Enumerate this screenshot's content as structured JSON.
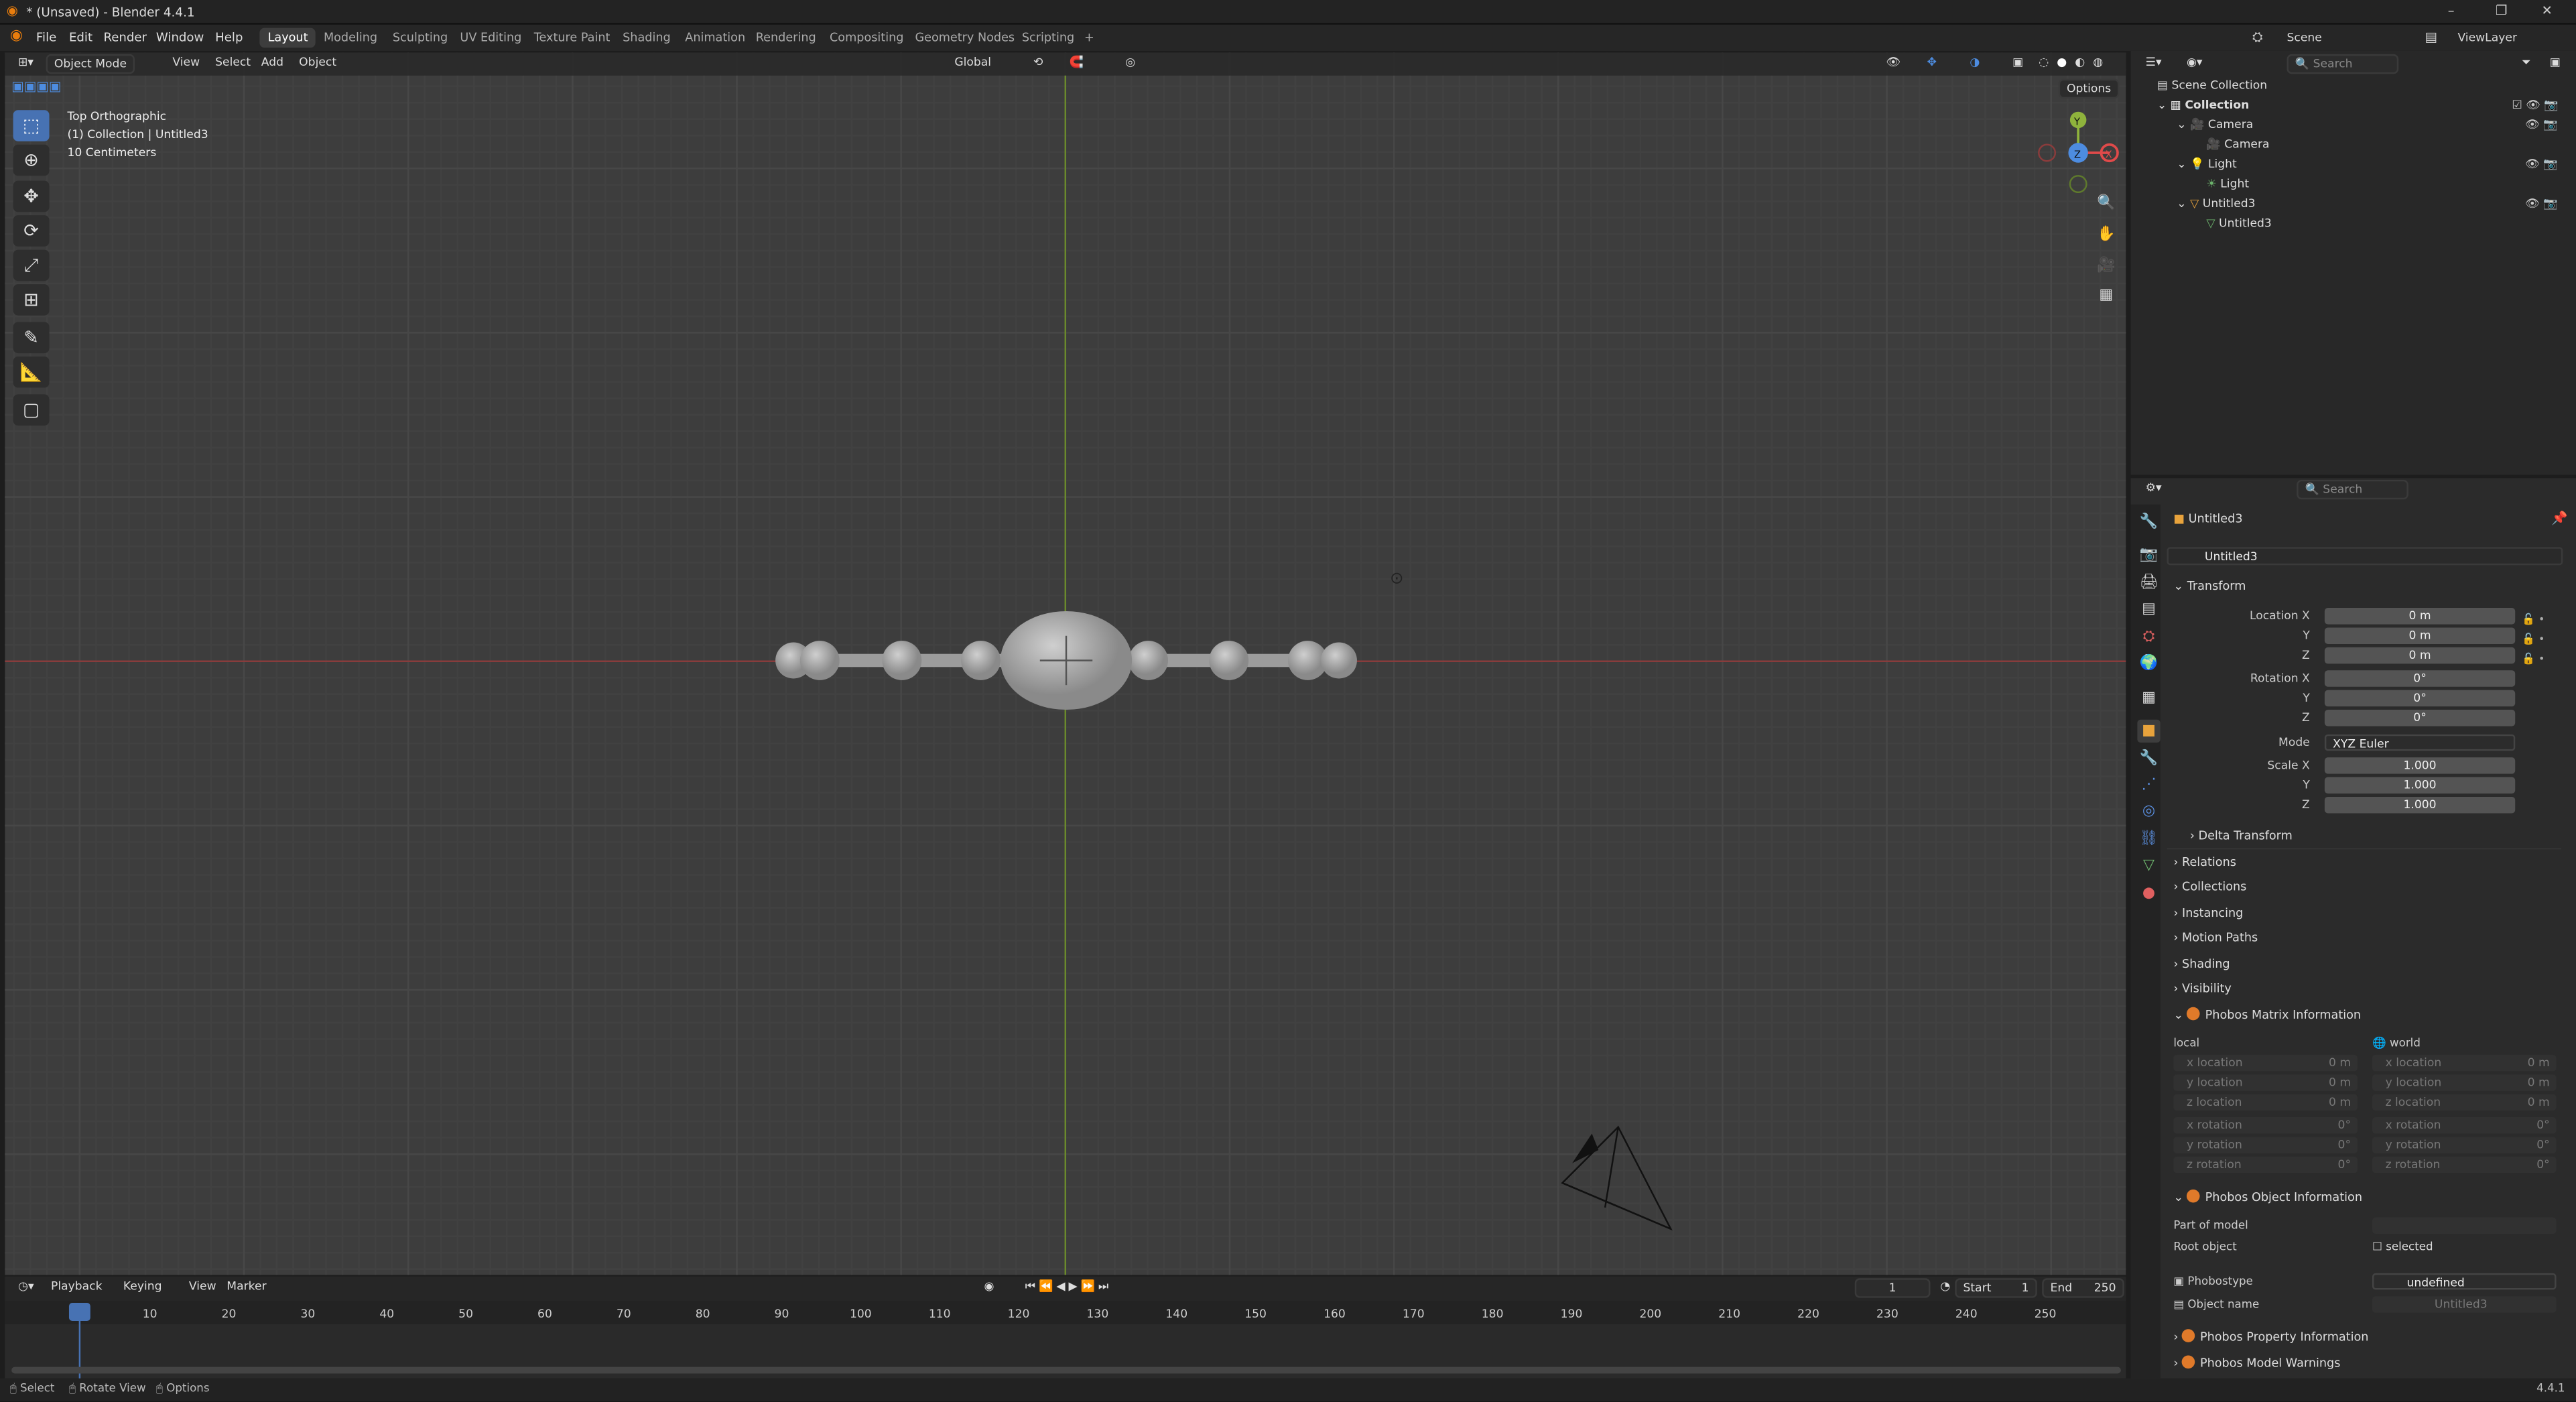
{
  "window": {
    "title": "* (Unsaved) - Blender 4.4.1"
  },
  "menus": [
    "File",
    "Edit",
    "Render",
    "Window",
    "Help"
  ],
  "workspaces": [
    "Layout",
    "Modeling",
    "Sculpting",
    "UV Editing",
    "Texture Paint",
    "Shading",
    "Animation",
    "Rendering",
    "Compositing",
    "Geometry Nodes",
    "Scripting",
    "+"
  ],
  "active_workspace": "Layout",
  "scene": {
    "name": "Scene",
    "view_layer": "ViewLayer"
  },
  "viewport": {
    "mode": "Object Mode",
    "menus": [
      "View",
      "Select",
      "Add",
      "Object"
    ],
    "orientation": "Global",
    "options": "Options",
    "overlay": [
      "Top Orthographic",
      "(1) Collection | Untitled3",
      "10 Centimeters"
    ],
    "axes": {
      "y": "Y",
      "z": "Z",
      "x": "X"
    }
  },
  "outliner": {
    "search_placeholder": "Search",
    "items": [
      "Scene Collection",
      "Collection",
      "Camera",
      "Camera",
      "Light",
      "Light",
      "Untitled3",
      "Untitled3"
    ]
  },
  "properties": {
    "search_placeholder": "Search",
    "object_name": "Untitled3",
    "datablock": "Untitled3",
    "transform": {
      "title": "Transform",
      "location": {
        "label": "Location X",
        "x": "0 m",
        "y": "0 m",
        "z": "0 m"
      },
      "rotation": {
        "label": "Rotation X",
        "x": "0°",
        "y": "0°",
        "z": "0°"
      },
      "mode_label": "Mode",
      "mode": "XYZ Euler",
      "scale": {
        "label": "Scale X",
        "x": "1.000",
        "y": "1.000",
        "z": "1.000"
      },
      "y": "Y",
      "z": "Z"
    },
    "panels": [
      "Delta Transform",
      "Relations",
      "Collections",
      "Instancing",
      "Motion Paths",
      "Shading",
      "Visibility"
    ],
    "phobos_matrix": {
      "title": "Phobos Matrix Information",
      "local": "local",
      "world": "world",
      "loc_labels": [
        "x location",
        "y location",
        "z location"
      ],
      "rot_labels": [
        "x rotation",
        "y rotation",
        "z rotation"
      ],
      "loc_value": "0 m",
      "rot_value": "0°"
    },
    "phobos_object": {
      "title": "Phobos Object Information",
      "part_of_model": "Part of model",
      "root_object": "Root object",
      "selected": "selected",
      "phobostype_label": "Phobostype",
      "phobostype": "undefined",
      "object_name_label": "Object name",
      "object_name": "Untitled3"
    },
    "phobos_property": "Phobos Property Information",
    "phobos_warnings": "Phobos Model Warnings"
  },
  "timeline": {
    "menus": [
      "Playback",
      "Keying",
      "View",
      "Marker"
    ],
    "current": "1",
    "start_label": "Start",
    "start": "1",
    "end_label": "End",
    "end": "250",
    "ticks": [
      "1",
      "10",
      "20",
      "30",
      "40",
      "50",
      "60",
      "70",
      "80",
      "90",
      "100",
      "110",
      "120",
      "130",
      "140",
      "150",
      "160",
      "170",
      "180",
      "190",
      "200",
      "210",
      "220",
      "230",
      "240",
      "250"
    ]
  },
  "status": {
    "select": "Select",
    "rotate": "Rotate View",
    "options": "Options",
    "version": "4.4.1"
  }
}
